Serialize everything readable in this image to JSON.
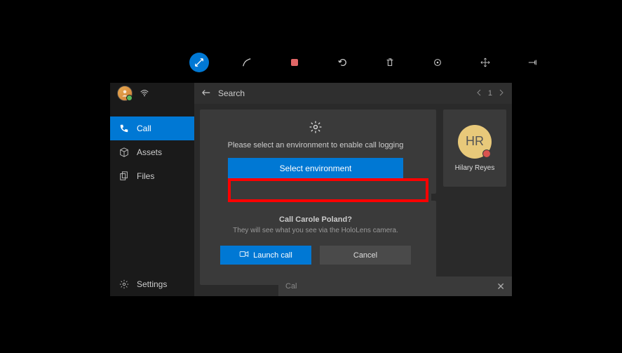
{
  "toolbar": {
    "icons": [
      "expand-icon",
      "annotate-icon",
      "record-icon",
      "undo-icon",
      "trash-icon",
      "chat-icon",
      "move-icon",
      "pin-icon"
    ]
  },
  "sidebar": {
    "items": [
      {
        "icon": "phone",
        "label": "Call"
      },
      {
        "icon": "cube",
        "label": "Assets"
      },
      {
        "icon": "files",
        "label": "Files"
      }
    ],
    "settings": {
      "icon": "gear",
      "label": "Settings"
    }
  },
  "topbar": {
    "search": "Search",
    "page": "1"
  },
  "contact": {
    "initials": "HR",
    "name": "Hilary Reyes"
  },
  "modal": {
    "prompt": "Please select an environment to enable call logging",
    "button": "Select environment",
    "call_title": "Call Carole Poland?",
    "call_sub": "They will see what you see via the HoloLens camera.",
    "launch": "Launch call",
    "cancel": "Cancel"
  },
  "bottombar": {
    "text": "Cal"
  }
}
